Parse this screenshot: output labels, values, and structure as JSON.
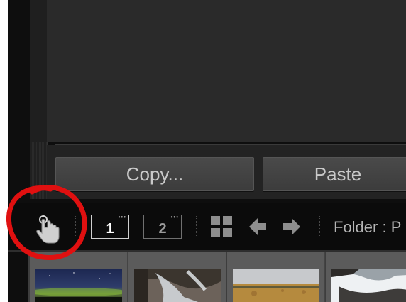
{
  "actions": {
    "copy_label": "Copy...",
    "paste_label": "Paste"
  },
  "toolbar": {
    "hand_tool_icon": "hand-pointer-icon",
    "screen_primary_number": "1",
    "screen_secondary_number": "2",
    "grid_icon": "grid-view-icon",
    "prev_icon": "arrow-left-icon",
    "next_icon": "arrow-right-icon",
    "folder_label": "Folder : P"
  },
  "filmstrip": {
    "thumbnails": [
      {
        "icon": "night-sky-photo"
      },
      {
        "icon": "waterfall-photo"
      },
      {
        "icon": "hay-field-photo"
      },
      {
        "icon": "snowy-stream-photo"
      }
    ]
  },
  "annotation": {
    "color": "#e01010",
    "highlighted": "hand-tool"
  },
  "colors": {
    "panel": "#2a2a2a",
    "toolbar": "#0b0b0b",
    "button": "#444444",
    "text": "#c9c9c9"
  }
}
